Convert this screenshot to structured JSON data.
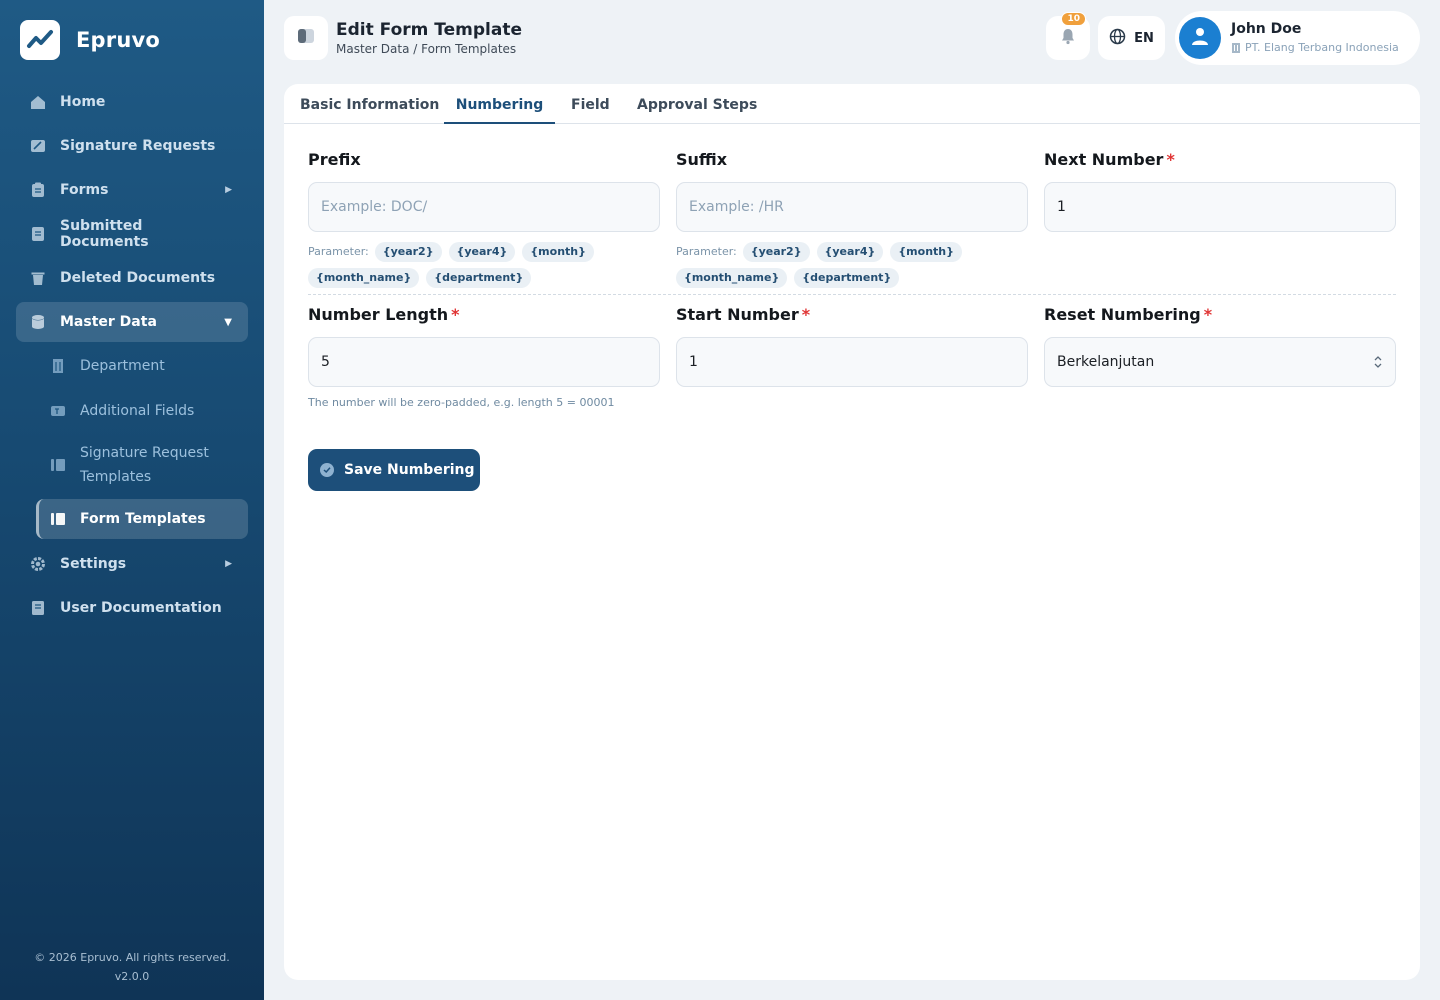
{
  "brand": {
    "name": "Epruvo"
  },
  "sidebar": {
    "items": [
      {
        "label": "Home",
        "icon": "home-icon"
      },
      {
        "label": "Signature Requests",
        "icon": "signature-icon"
      },
      {
        "label": "Forms",
        "icon": "clipboard-icon"
      },
      {
        "label": "Submitted Documents",
        "icon": "document-icon"
      },
      {
        "label": "Deleted Documents",
        "icon": "trash-icon"
      },
      {
        "label": "Master Data",
        "icon": "database-icon"
      }
    ],
    "master_sub": [
      {
        "label": "Department",
        "icon": "building-icon"
      },
      {
        "label": "Additional Fields",
        "icon": "text-field-icon"
      },
      {
        "label": "Signature Request Templates",
        "icon": "template-icon"
      },
      {
        "label": "Form Templates",
        "icon": "template-icon"
      }
    ],
    "bottom_items": [
      {
        "label": "Settings",
        "icon": "gear-icon"
      },
      {
        "label": "User Documentation",
        "icon": "book-icon"
      }
    ],
    "footer": {
      "copyright": "© 2026 Epruvo. All rights reserved.",
      "version": "v2.0.0"
    }
  },
  "header": {
    "title": "Edit Form Template",
    "breadcrumb": "Master Data / Form Templates",
    "notification_count": "10",
    "language": "EN",
    "user": {
      "name": "John Doe",
      "organization": "PT. Elang Terbang Indonesia"
    }
  },
  "tabs": [
    {
      "label": "Basic Information"
    },
    {
      "label": "Numbering"
    },
    {
      "label": "Field"
    },
    {
      "label": "Approval Steps"
    }
  ],
  "form": {
    "prefix": {
      "label": "Prefix",
      "placeholder": "Example: DOC/",
      "value": ""
    },
    "suffix": {
      "label": "Suffix",
      "placeholder": "Example: /HR",
      "value": ""
    },
    "next_number": {
      "label": "Next Number",
      "required": "*",
      "value": "1"
    },
    "parameter_label": "Parameter:",
    "parameters": [
      "{year2}",
      "{year4}",
      "{month}",
      "{month_name}",
      "{department}"
    ],
    "number_length": {
      "label": "Number Length",
      "required": "*",
      "value": "5",
      "hint": "The number will be zero-padded, e.g. length 5 = 00001"
    },
    "start_number": {
      "label": "Start Number",
      "required": "*",
      "value": "1"
    },
    "reset_numbering": {
      "label": "Reset Numbering",
      "required": "*",
      "value": "Berkelanjutan"
    },
    "save_label": "Save Numbering"
  },
  "colors": {
    "sidebar_top": "#1f5a85",
    "sidebar_bottom": "#0f3456",
    "primary": "#1d4f7a",
    "badge": "#f0a03c",
    "required": "#e03434"
  }
}
